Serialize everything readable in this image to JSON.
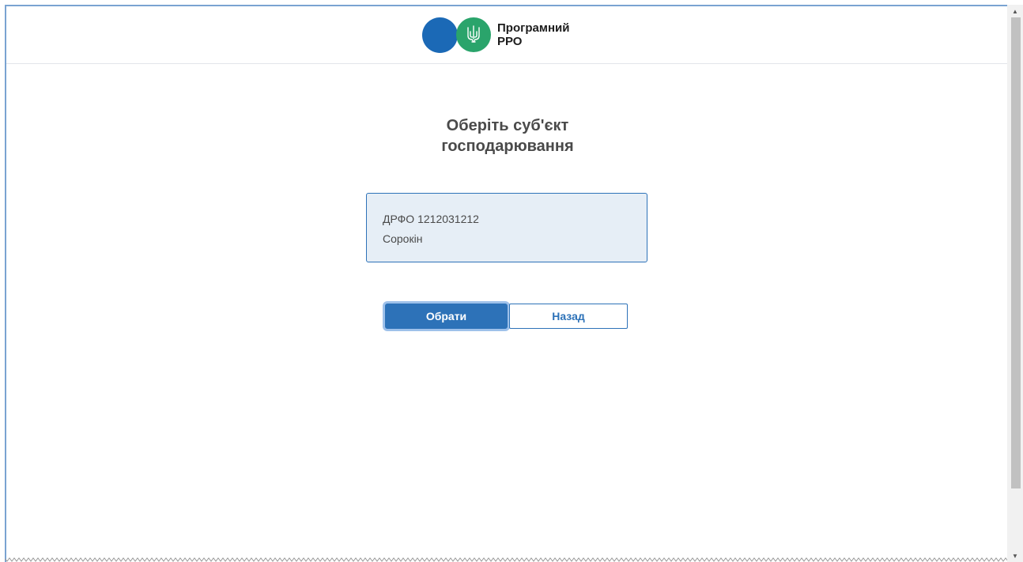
{
  "header": {
    "logo_line1": "Програмний",
    "logo_line2": "РРО",
    "logo_icon": "trident-icon"
  },
  "main": {
    "title_line1": "Оберіть суб'єкт",
    "title_line2": "господарювання",
    "entity": {
      "id_text": "ДРФО 1212031212",
      "name": "Сорокін"
    },
    "select_button": "Обрати",
    "back_button": "Назад"
  },
  "colors": {
    "primary": "#2d72b8",
    "logo_blue": "#1b69b6",
    "logo_green": "#2aa46b",
    "card_bg": "#e6eef6",
    "focus_ring": "#9ec1ea"
  }
}
